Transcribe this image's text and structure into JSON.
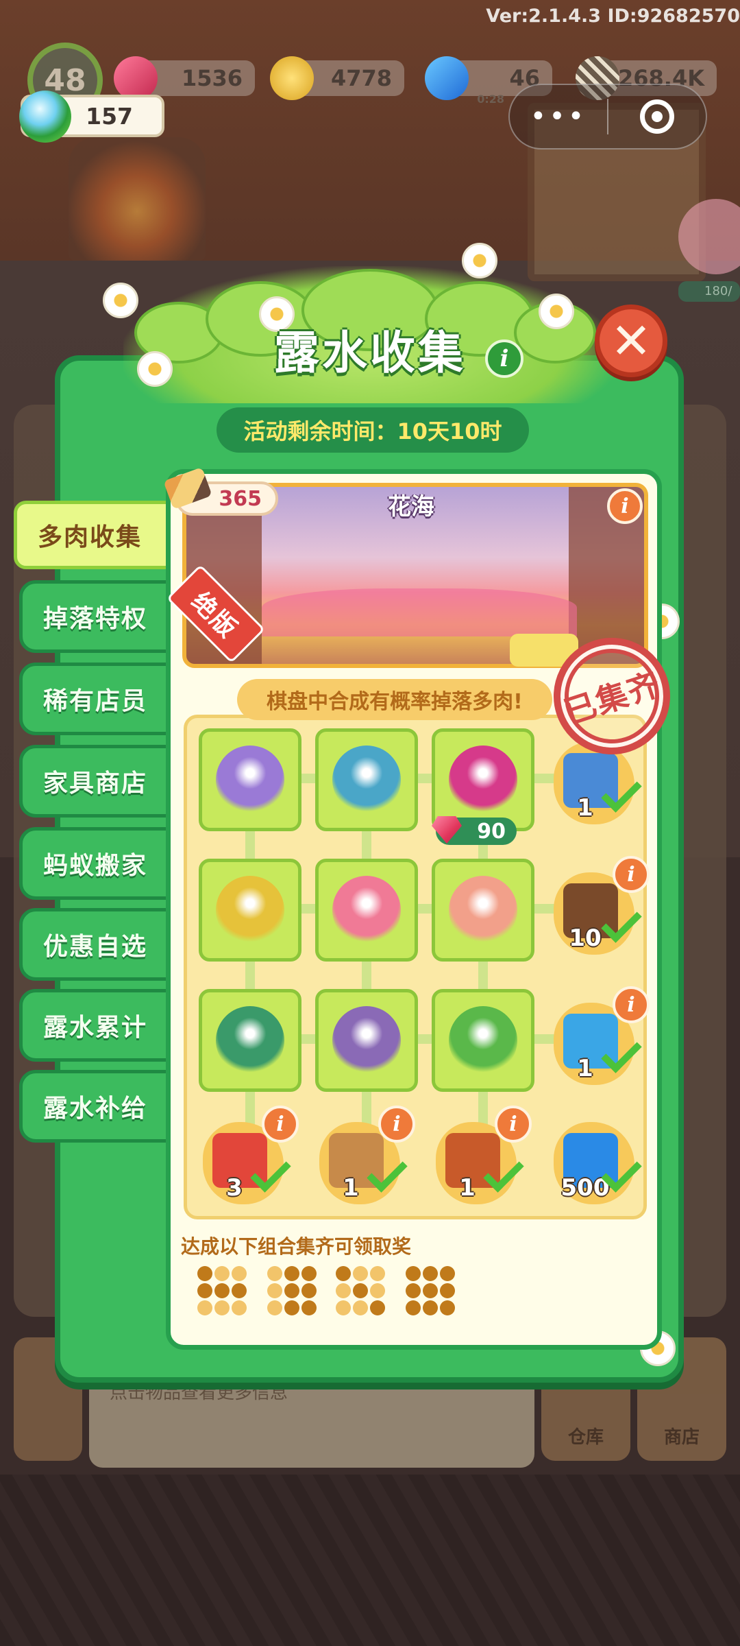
{
  "hud": {
    "version_text": "Ver:2.1.4.3 ID:92682570",
    "level": "48",
    "gems": "1536",
    "coins": "4778",
    "energy": "46",
    "energy_sub": "0:28",
    "seeds": "268.4K",
    "dew": "157"
  },
  "mini_program": {
    "menu_label": "•••"
  },
  "background": {
    "bottom_hint": "点击物品查看更多信息",
    "warehouse_label": "仓库",
    "shop_label": "商店",
    "pig_progress": "180/"
  },
  "modal": {
    "title": "露水收集",
    "info_symbol": "i",
    "close_symbol": "✕",
    "timer_text": "活动剩余时间：10天10时"
  },
  "tabs": [
    {
      "label": "多肉收集",
      "active": true
    },
    {
      "label": "掉落特权",
      "active": false
    },
    {
      "label": "稀有店员",
      "active": false
    },
    {
      "label": "家具商店",
      "active": false
    },
    {
      "label": "蚂蚁搬家",
      "active": false
    },
    {
      "label": "优惠自选",
      "active": false
    },
    {
      "label": "露水累计",
      "active": false
    },
    {
      "label": "露水补给",
      "active": false
    }
  ],
  "banner": {
    "title": "花海",
    "pencil_count": "365",
    "ribbon": "绝版",
    "stamp": "已集齐"
  },
  "collection": {
    "hint": "棋盘中合成有概率掉落多肉!",
    "price": "90",
    "cells": [
      {
        "name": "purple-succulent",
        "color": "#9a7ad6"
      },
      {
        "name": "blue-succulent",
        "color": "#4aa6c8"
      },
      {
        "name": "magenta-succulent",
        "color": "#d63a8a"
      },
      {
        "name": "yellow-flower-pot",
        "color": "#e6c23a"
      },
      {
        "name": "pink-succulent-pot",
        "color": "#f07a96"
      },
      {
        "name": "peach-succulent",
        "color": "#f2a08a"
      },
      {
        "name": "green-succulent-bowl",
        "color": "#3a9a6a"
      },
      {
        "name": "mixed-planter-box",
        "color": "#8a6ab6"
      },
      {
        "name": "green-rosette-pot",
        "color": "#5ab84a"
      }
    ],
    "row_rewards": [
      {
        "count": "1",
        "item": "chest",
        "color": "#4a8ad6"
      },
      {
        "count": "10",
        "item": "bag",
        "color": "#7a4a2a"
      },
      {
        "count": "1",
        "item": "blue-box",
        "color": "#3aa6e6"
      }
    ],
    "col_rewards": [
      {
        "count": "3",
        "item": "scissors",
        "color": "#e2463a"
      },
      {
        "count": "1",
        "item": "house",
        "color": "#c78a4a"
      },
      {
        "count": "1",
        "item": "treasure-chest",
        "color": "#c85a2a"
      },
      {
        "count": "500",
        "item": "lightning",
        "color": "#2a8ae6"
      }
    ]
  },
  "combos": {
    "title": "达成以下组合集齐可领取奖",
    "patterns": [
      [
        1,
        0,
        0,
        1,
        1,
        1,
        0,
        0,
        0
      ],
      [
        0,
        1,
        1,
        0,
        1,
        1,
        0,
        1,
        1
      ],
      [
        1,
        0,
        0,
        0,
        1,
        0,
        0,
        0,
        1
      ],
      [
        1,
        1,
        1,
        1,
        1,
        1,
        1,
        1,
        1
      ]
    ]
  },
  "colors": {
    "modal_green": "#3cbb5e",
    "modal_border": "#1f8a43",
    "timer_text": "#ffe96a",
    "close_red": "#e55a3e",
    "cell_green": "#c7e95c",
    "check_green": "#4cc23a",
    "stamp_red": "#d34a48"
  }
}
